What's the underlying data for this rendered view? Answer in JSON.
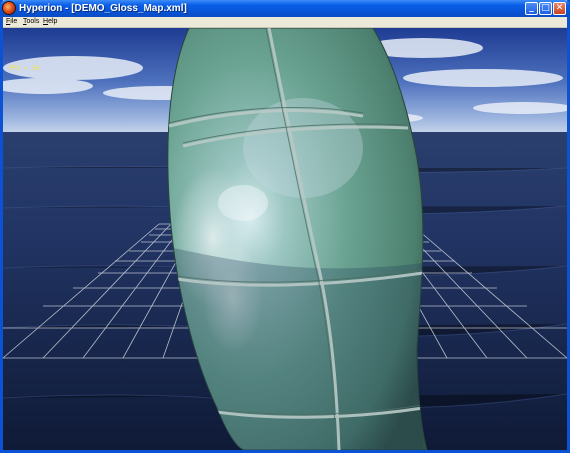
{
  "window": {
    "title": "Hyperion - [DEMO_Gloss_Map.xml]",
    "controls": {
      "minimize": "_",
      "maximize": "□",
      "close": "✕"
    }
  },
  "menu": {
    "items": [
      {
        "label": "File",
        "access_key": "F"
      },
      {
        "label": "Tools",
        "access_key": "T"
      },
      {
        "label": "Help",
        "access_key": "H"
      }
    ]
  },
  "viewport": {
    "fps_label": "FPS = 58",
    "scene": "3D render of a glossy tiled torus over an ocean plane with a reflective grid",
    "colors": {
      "sky": "#5c7fc6",
      "ocean": "#1a2c56",
      "object": "#5f9a86",
      "grid": "#d7d9e0",
      "fps": "#f5e33a"
    }
  },
  "icons": {
    "app": "app-icon"
  }
}
